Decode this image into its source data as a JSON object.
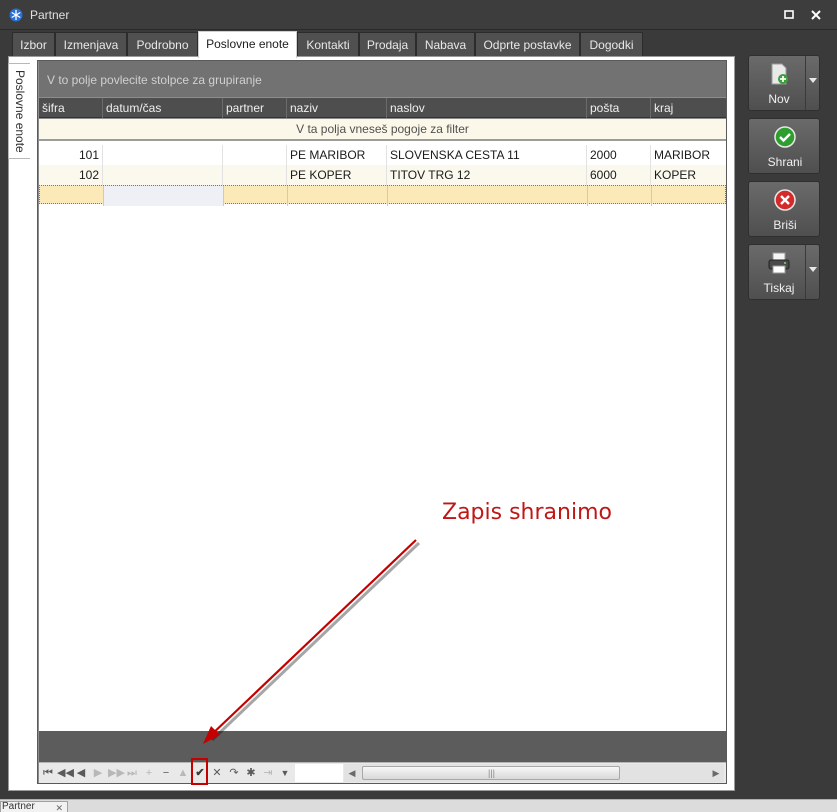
{
  "window": {
    "title": "Partner"
  },
  "tabs": [
    {
      "label": "Izbor",
      "active": false
    },
    {
      "label": "Izmenjava",
      "active": false
    },
    {
      "label": "Podrobno",
      "active": false
    },
    {
      "label": "Poslovne enote",
      "active": true
    },
    {
      "label": "Kontakti",
      "active": false
    },
    {
      "label": "Prodaja",
      "active": false
    },
    {
      "label": "Nabava",
      "active": false
    },
    {
      "label": "Odprte postavke",
      "active": false
    },
    {
      "label": "Dogodki",
      "active": false
    }
  ],
  "side_tab": {
    "label": "Poslovne enote"
  },
  "grid": {
    "group_panel_text": "V to polje povlecite stolpce za grupiranje",
    "filter_text": "V ta polja vneseš pogoje za filter",
    "columns": [
      "šifra",
      "datum/čas",
      "partner",
      "naziv",
      "naslov",
      "pošta",
      "kraj"
    ],
    "rows": [
      {
        "sifra": "101",
        "datum": "",
        "partner": "",
        "naziv": "PE MARIBOR",
        "naslov": "SLOVENSKA CESTA 11",
        "posta": "2000",
        "kraj": "MARIBOR"
      },
      {
        "sifra": "102",
        "datum": "",
        "partner": "",
        "naziv": "PE KOPER",
        "naslov": "TITOV TRG 12",
        "posta": "6000",
        "kraj": "KOPER"
      }
    ]
  },
  "navigator": {
    "buttons": [
      {
        "name": "first-icon",
        "glyph": "⏮",
        "enabled": true
      },
      {
        "name": "prev-page-icon",
        "glyph": "◀◀",
        "enabled": true
      },
      {
        "name": "prev-icon",
        "glyph": "◀",
        "enabled": true
      },
      {
        "name": "next-icon",
        "glyph": "▶",
        "enabled": false
      },
      {
        "name": "next-page-icon",
        "glyph": "▶▶",
        "enabled": false
      },
      {
        "name": "last-icon",
        "glyph": "⏭",
        "enabled": false
      },
      {
        "name": "append-icon",
        "glyph": "+",
        "enabled": false
      },
      {
        "name": "delete-icon",
        "glyph": "−",
        "enabled": true
      },
      {
        "name": "edit-icon",
        "glyph": "▲",
        "enabled": false
      },
      {
        "name": "post-icon",
        "glyph": "✔",
        "enabled": true
      },
      {
        "name": "cancel-icon",
        "glyph": "✕",
        "enabled": true
      },
      {
        "name": "refresh-icon",
        "glyph": "↷",
        "enabled": true
      },
      {
        "name": "bookmark-icon",
        "glyph": "✱",
        "enabled": true
      },
      {
        "name": "goto-bookmark-icon",
        "glyph": "⇥",
        "enabled": false
      },
      {
        "name": "filter-icon",
        "glyph": "▼",
        "enabled": true
      }
    ],
    "record_input": ""
  },
  "actions": {
    "new_label": "Nov",
    "save_label": "Shrani",
    "delete_label": "Briši",
    "print_label": "Tiskaj"
  },
  "annotation": {
    "text": "Zapis shranimo",
    "color": "#c11616"
  },
  "taskbar": {
    "tab_label": "Partner"
  },
  "colors": {
    "accent_save": "#2e9e2e",
    "accent_delete": "#d42a2a",
    "filter_row_bg": "#fbf8e9",
    "new_row_bg": "#fbe9b7"
  }
}
